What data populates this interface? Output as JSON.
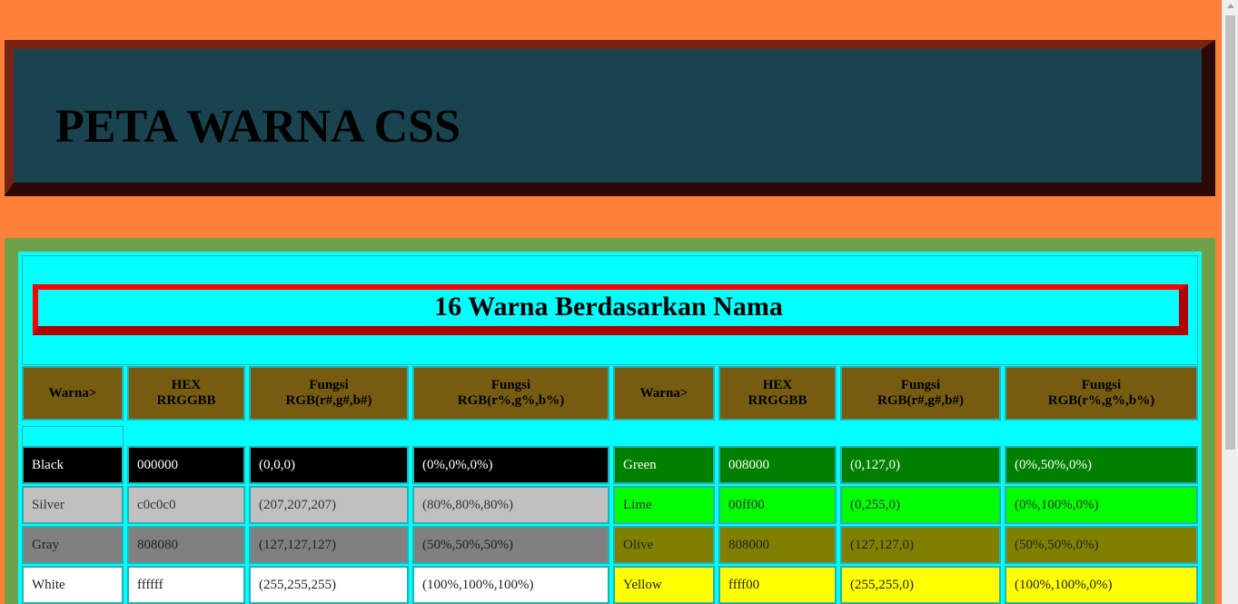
{
  "header": {
    "title": "PETA WARNA CSS"
  },
  "section": {
    "title": "16 Warna Berdasarkan Nama"
  },
  "table": {
    "headers": [
      [
        "Warna>"
      ],
      [
        "HEX",
        "RRGGBB"
      ],
      [
        "Fungsi",
        "RGB(r#,g#,b#)"
      ],
      [
        "Fungsi",
        "RGB(r%,g%,b%)"
      ],
      [
        "Warna>"
      ],
      [
        "HEX",
        "RRGGBB"
      ],
      [
        "Fungsi",
        "RGB(r#,g#,b#)"
      ],
      [
        "Fungsi",
        "RGB(r%,g%,b%)"
      ]
    ],
    "rows": [
      {
        "left": {
          "name": "Black",
          "hex": "000000",
          "rgb": "(0,0,0)",
          "pct": "(0%,0%,0%)",
          "bg": "#000000",
          "fg": "#ffffff"
        },
        "right": {
          "name": "Green",
          "hex": "008000",
          "rgb": "(0,127,0)",
          "pct": "(0%,50%,0%)",
          "bg": "#008000",
          "fg": "#ffffff"
        }
      },
      {
        "left": {
          "name": "Silver",
          "hex": "c0c0c0",
          "rgb": "(207,207,207)",
          "pct": "(80%,80%,80%)",
          "bg": "#c0c0c0",
          "fg": "#333333"
        },
        "right": {
          "name": "Lime",
          "hex": "00ff00",
          "rgb": "(0,255,0)",
          "pct": "(0%,100%,0%)",
          "bg": "#00ff00",
          "fg": "#333333"
        }
      },
      {
        "left": {
          "name": "Gray",
          "hex": "808080",
          "rgb": "(127,127,127)",
          "pct": "(50%,50%,50%)",
          "bg": "#808080",
          "fg": "#222222"
        },
        "right": {
          "name": "Olive",
          "hex": "808000",
          "rgb": "(127,127,0)",
          "pct": "(50%,50%,0%)",
          "bg": "#808000",
          "fg": "#222222"
        }
      },
      {
        "left": {
          "name": "White",
          "hex": "ffffff",
          "rgb": "(255,255,255)",
          "pct": "(100%,100%,100%)",
          "bg": "#ffffff",
          "fg": "#222222"
        },
        "right": {
          "name": "Yellow",
          "hex": "ffff00",
          "rgb": "(255,255,0)",
          "pct": "(100%,100%,0%)",
          "bg": "#ffff00",
          "fg": "#222222"
        }
      }
    ]
  },
  "colors": {
    "page_bg": "#ff8139",
    "header_bg": "#1a4350",
    "content_frame": "#6ea04a",
    "content_bg": "#00ffff",
    "table_header_bg": "#765c10",
    "title_border": "#ff0000"
  }
}
